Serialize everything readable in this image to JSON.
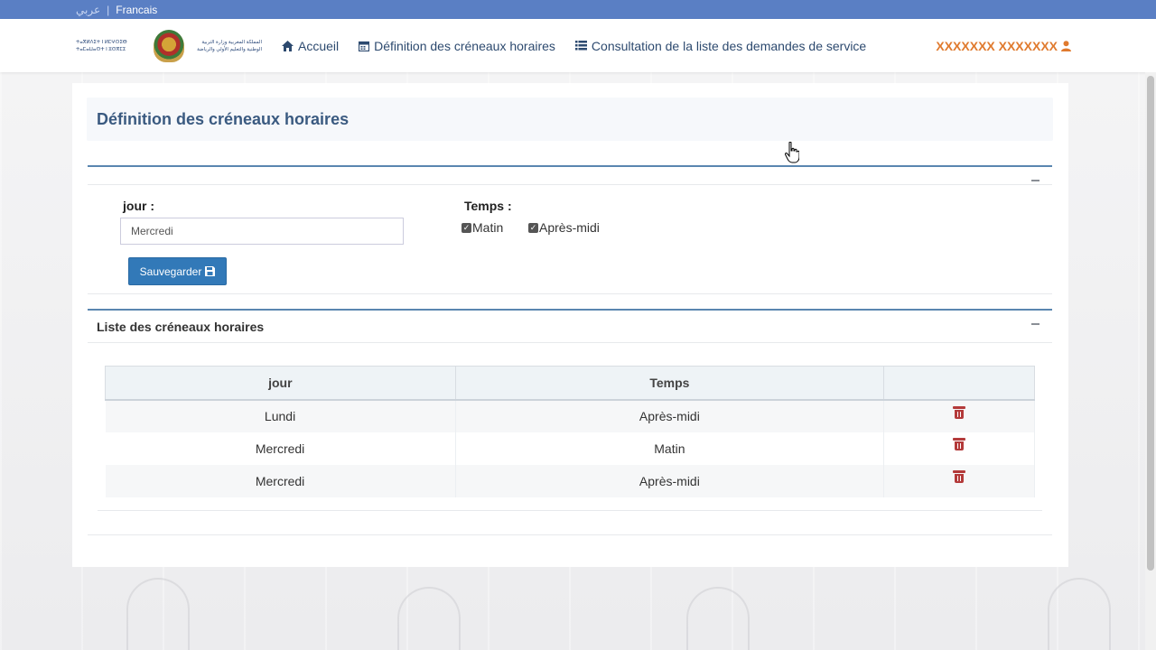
{
  "topbar": {
    "lang_ar": "عربي",
    "separator": "|",
    "lang_fr": "Francais"
  },
  "header": {
    "logo_text_left": "ⵜⴰⴳⵍⴷⵉⵜ ⵏ ⵍⵎⵖⵔⵉⴱ ⵜⴰⵎⴰⵡⴰⵙⵜ ⵏ ⵓⵙⴳⵎⵉ",
    "logo_text_right": "المملكة المغربية وزارة التربية الوطنية والتعليم الأولي والرياضة",
    "nav": [
      {
        "icon": "home-icon",
        "label": "Accueil"
      },
      {
        "icon": "calendar-icon",
        "label": "Définition des créneaux horaires"
      },
      {
        "icon": "list-icon",
        "label": "Consultation de la liste des demandes de service"
      }
    ],
    "user": {
      "name": "XXXXXXX XXXXXXX",
      "icon": "user-icon"
    }
  },
  "page": {
    "title": "Définition des créneaux horaires",
    "form": {
      "jour_label": "jour :",
      "jour_value": "Mercredi",
      "temps_label": "Temps :",
      "options": [
        {
          "label": "Matin",
          "checked": true
        },
        {
          "label": "Après-midi",
          "checked": true
        }
      ],
      "save_label": "Sauvegarder"
    },
    "list": {
      "title": "Liste des créneaux horaires",
      "headers": [
        "jour",
        "Temps",
        ""
      ],
      "rows": [
        {
          "jour": "Lundi",
          "temps": "Après-midi"
        },
        {
          "jour": "Mercredi",
          "temps": "Matin"
        },
        {
          "jour": "Mercredi",
          "temps": "Après-midi"
        }
      ]
    }
  },
  "colors": {
    "topbar": "#5a7fc4",
    "accent": "#3279b8",
    "user": "#e07a2e",
    "danger": "#b33a3a"
  }
}
